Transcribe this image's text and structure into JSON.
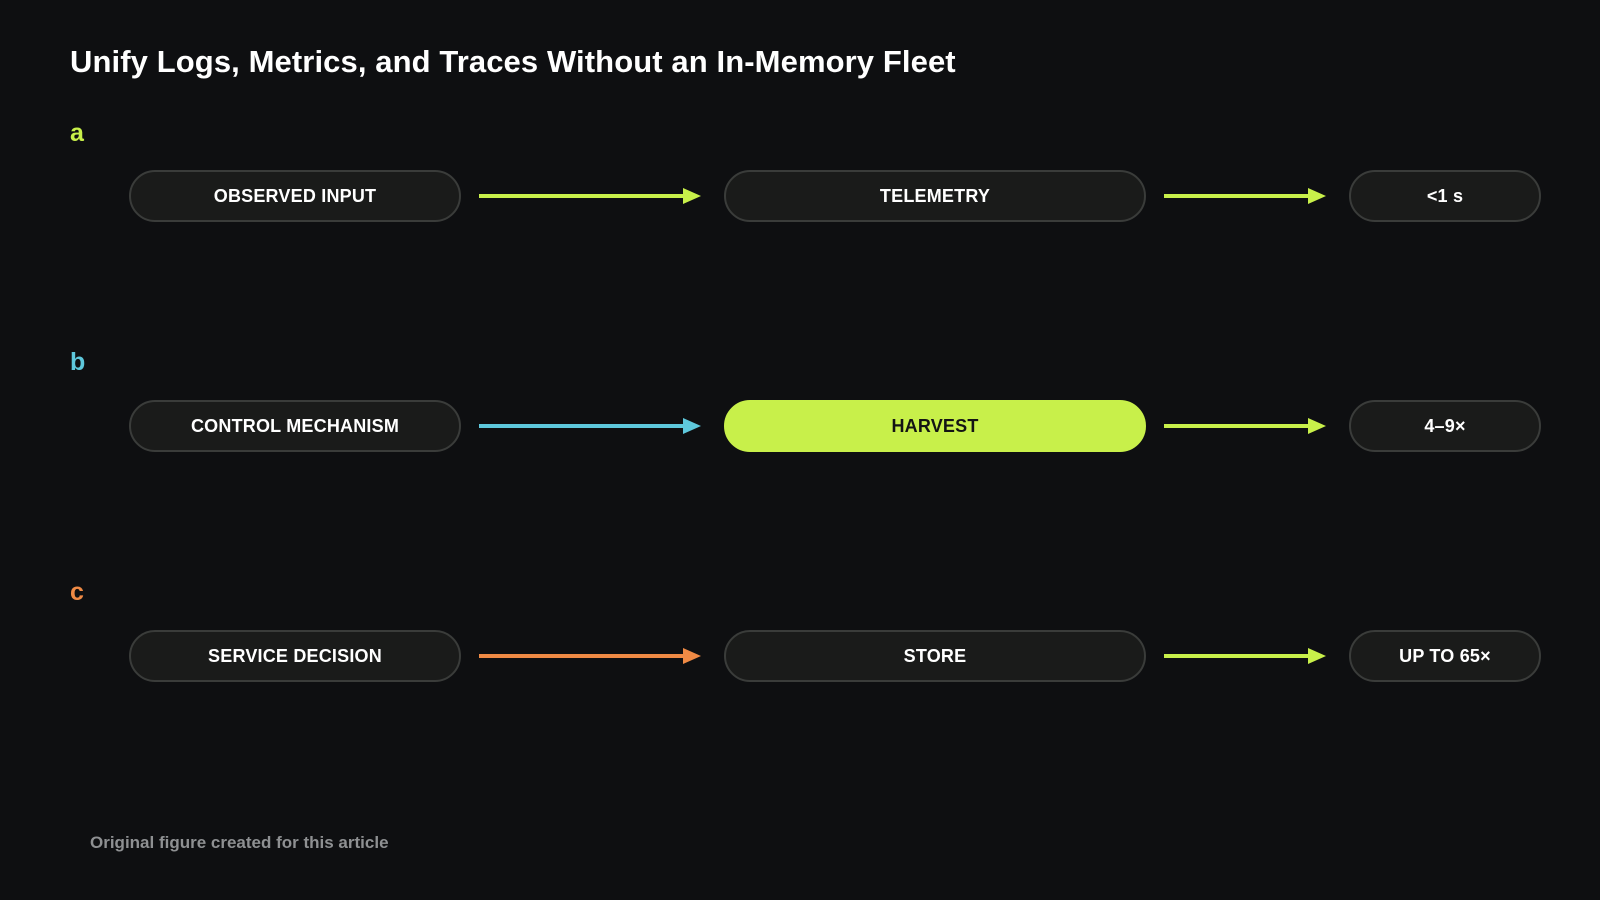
{
  "title": "Unify Logs, Metrics, and Traces Without an In-Memory Fleet",
  "caption": "Original figure created for this article",
  "colors": {
    "background": "#0e0f11",
    "accent_lime": "#c8f04a",
    "accent_cyan": "#5ec8dc",
    "accent_orange": "#ef8a45",
    "pill_fill": "#1a1b1a",
    "pill_border": "#3a3c3a",
    "caption_gray": "#8e9092"
  },
  "rows": [
    {
      "label": "a",
      "label_color": "#c8f04a",
      "input": "OBSERVED INPUT",
      "input_arrow_color": "#c8f04a",
      "middle": "TELEMETRY",
      "middle_highlighted": false,
      "output_arrow_color": "#c8f04a",
      "output": "<1 s"
    },
    {
      "label": "b",
      "label_color": "#5ec8dc",
      "input": "CONTROL MECHANISM",
      "input_arrow_color": "#5ec8dc",
      "middle": "HARVEST",
      "middle_highlighted": true,
      "output_arrow_color": "#c8f04a",
      "output": "4–9×"
    },
    {
      "label": "c",
      "label_color": "#ef8a45",
      "input": "SERVICE DECISION",
      "input_arrow_color": "#ef8a45",
      "middle": "STORE",
      "middle_highlighted": false,
      "output_arrow_color": "#c8f04a",
      "output": "UP TO 65×"
    }
  ]
}
